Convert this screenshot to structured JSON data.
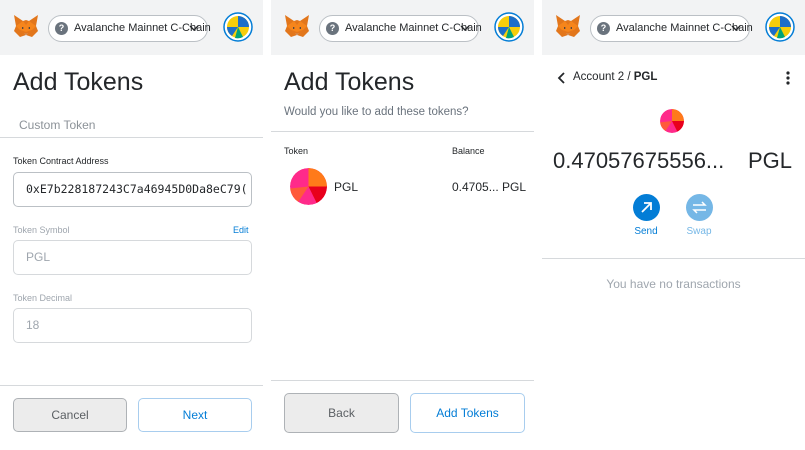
{
  "network": {
    "label": "Avalanche Mainnet C-Chain"
  },
  "panel1": {
    "title": "Add Tokens",
    "tab": "Custom Token",
    "contract_label": "Token Contract Address",
    "contract_value": "0xE7b228187243C7a46945D0Da8eC79(",
    "symbol_label": "Token Symbol",
    "symbol_edit": "Edit",
    "symbol_value": "PGL",
    "decimal_label": "Token Decimal",
    "decimal_value": "18",
    "cancel": "Cancel",
    "next": "Next"
  },
  "panel2": {
    "title": "Add Tokens",
    "subtitle": "Would you like to add these tokens?",
    "col_token": "Token",
    "col_balance": "Balance",
    "token_symbol": "PGL",
    "token_balance": "0.4705... PGL",
    "back": "Back",
    "add": "Add Tokens"
  },
  "panel3": {
    "account": "Account 2",
    "separator": " / ",
    "token": "PGL",
    "balance_value": "0.47057675556...",
    "balance_symbol": "PGL",
    "send": "Send",
    "swap": "Swap",
    "empty": "You have no transactions"
  },
  "colors": {
    "accent": "#037dd6",
    "accent_disabled": "#75b7e6",
    "topbar": "#f2f3f4",
    "pgl_pink": "#ff2a8a",
    "pgl_orange": "#ff7a1a"
  },
  "icons": {
    "fox": "metamask-fox-icon",
    "network": "question-icon",
    "chevron": "chevron-down-icon",
    "avatar": "account-avatar",
    "back": "chevron-left-icon",
    "menu": "kebab-menu-icon",
    "send": "arrow-up-right-icon",
    "swap": "swap-arrows-icon"
  }
}
